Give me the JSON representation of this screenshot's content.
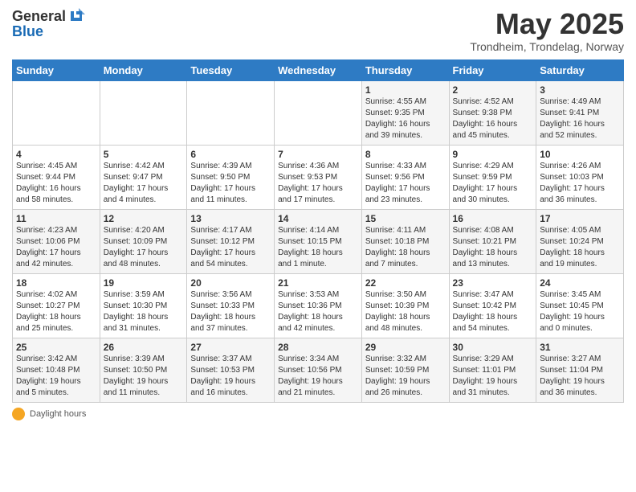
{
  "header": {
    "logo_general": "General",
    "logo_blue": "Blue",
    "title": "May 2025",
    "subtitle": "Trondheim, Trondelag, Norway"
  },
  "columns": [
    "Sunday",
    "Monday",
    "Tuesday",
    "Wednesday",
    "Thursday",
    "Friday",
    "Saturday"
  ],
  "weeks": [
    [
      {
        "day": "",
        "info": ""
      },
      {
        "day": "",
        "info": ""
      },
      {
        "day": "",
        "info": ""
      },
      {
        "day": "",
        "info": ""
      },
      {
        "day": "1",
        "info": "Sunrise: 4:55 AM\nSunset: 9:35 PM\nDaylight: 16 hours\nand 39 minutes."
      },
      {
        "day": "2",
        "info": "Sunrise: 4:52 AM\nSunset: 9:38 PM\nDaylight: 16 hours\nand 45 minutes."
      },
      {
        "day": "3",
        "info": "Sunrise: 4:49 AM\nSunset: 9:41 PM\nDaylight: 16 hours\nand 52 minutes."
      }
    ],
    [
      {
        "day": "4",
        "info": "Sunrise: 4:45 AM\nSunset: 9:44 PM\nDaylight: 16 hours\nand 58 minutes."
      },
      {
        "day": "5",
        "info": "Sunrise: 4:42 AM\nSunset: 9:47 PM\nDaylight: 17 hours\nand 4 minutes."
      },
      {
        "day": "6",
        "info": "Sunrise: 4:39 AM\nSunset: 9:50 PM\nDaylight: 17 hours\nand 11 minutes."
      },
      {
        "day": "7",
        "info": "Sunrise: 4:36 AM\nSunset: 9:53 PM\nDaylight: 17 hours\nand 17 minutes."
      },
      {
        "day": "8",
        "info": "Sunrise: 4:33 AM\nSunset: 9:56 PM\nDaylight: 17 hours\nand 23 minutes."
      },
      {
        "day": "9",
        "info": "Sunrise: 4:29 AM\nSunset: 9:59 PM\nDaylight: 17 hours\nand 30 minutes."
      },
      {
        "day": "10",
        "info": "Sunrise: 4:26 AM\nSunset: 10:03 PM\nDaylight: 17 hours\nand 36 minutes."
      }
    ],
    [
      {
        "day": "11",
        "info": "Sunrise: 4:23 AM\nSunset: 10:06 PM\nDaylight: 17 hours\nand 42 minutes."
      },
      {
        "day": "12",
        "info": "Sunrise: 4:20 AM\nSunset: 10:09 PM\nDaylight: 17 hours\nand 48 minutes."
      },
      {
        "day": "13",
        "info": "Sunrise: 4:17 AM\nSunset: 10:12 PM\nDaylight: 17 hours\nand 54 minutes."
      },
      {
        "day": "14",
        "info": "Sunrise: 4:14 AM\nSunset: 10:15 PM\nDaylight: 18 hours\nand 1 minute."
      },
      {
        "day": "15",
        "info": "Sunrise: 4:11 AM\nSunset: 10:18 PM\nDaylight: 18 hours\nand 7 minutes."
      },
      {
        "day": "16",
        "info": "Sunrise: 4:08 AM\nSunset: 10:21 PM\nDaylight: 18 hours\nand 13 minutes."
      },
      {
        "day": "17",
        "info": "Sunrise: 4:05 AM\nSunset: 10:24 PM\nDaylight: 18 hours\nand 19 minutes."
      }
    ],
    [
      {
        "day": "18",
        "info": "Sunrise: 4:02 AM\nSunset: 10:27 PM\nDaylight: 18 hours\nand 25 minutes."
      },
      {
        "day": "19",
        "info": "Sunrise: 3:59 AM\nSunset: 10:30 PM\nDaylight: 18 hours\nand 31 minutes."
      },
      {
        "day": "20",
        "info": "Sunrise: 3:56 AM\nSunset: 10:33 PM\nDaylight: 18 hours\nand 37 minutes."
      },
      {
        "day": "21",
        "info": "Sunrise: 3:53 AM\nSunset: 10:36 PM\nDaylight: 18 hours\nand 42 minutes."
      },
      {
        "day": "22",
        "info": "Sunrise: 3:50 AM\nSunset: 10:39 PM\nDaylight: 18 hours\nand 48 minutes."
      },
      {
        "day": "23",
        "info": "Sunrise: 3:47 AM\nSunset: 10:42 PM\nDaylight: 18 hours\nand 54 minutes."
      },
      {
        "day": "24",
        "info": "Sunrise: 3:45 AM\nSunset: 10:45 PM\nDaylight: 19 hours\nand 0 minutes."
      }
    ],
    [
      {
        "day": "25",
        "info": "Sunrise: 3:42 AM\nSunset: 10:48 PM\nDaylight: 19 hours\nand 5 minutes."
      },
      {
        "day": "26",
        "info": "Sunrise: 3:39 AM\nSunset: 10:50 PM\nDaylight: 19 hours\nand 11 minutes."
      },
      {
        "day": "27",
        "info": "Sunrise: 3:37 AM\nSunset: 10:53 PM\nDaylight: 19 hours\nand 16 minutes."
      },
      {
        "day": "28",
        "info": "Sunrise: 3:34 AM\nSunset: 10:56 PM\nDaylight: 19 hours\nand 21 minutes."
      },
      {
        "day": "29",
        "info": "Sunrise: 3:32 AM\nSunset: 10:59 PM\nDaylight: 19 hours\nand 26 minutes."
      },
      {
        "day": "30",
        "info": "Sunrise: 3:29 AM\nSunset: 11:01 PM\nDaylight: 19 hours\nand 31 minutes."
      },
      {
        "day": "31",
        "info": "Sunrise: 3:27 AM\nSunset: 11:04 PM\nDaylight: 19 hours\nand 36 minutes."
      }
    ]
  ],
  "footer": {
    "daylight_label": "Daylight hours"
  }
}
